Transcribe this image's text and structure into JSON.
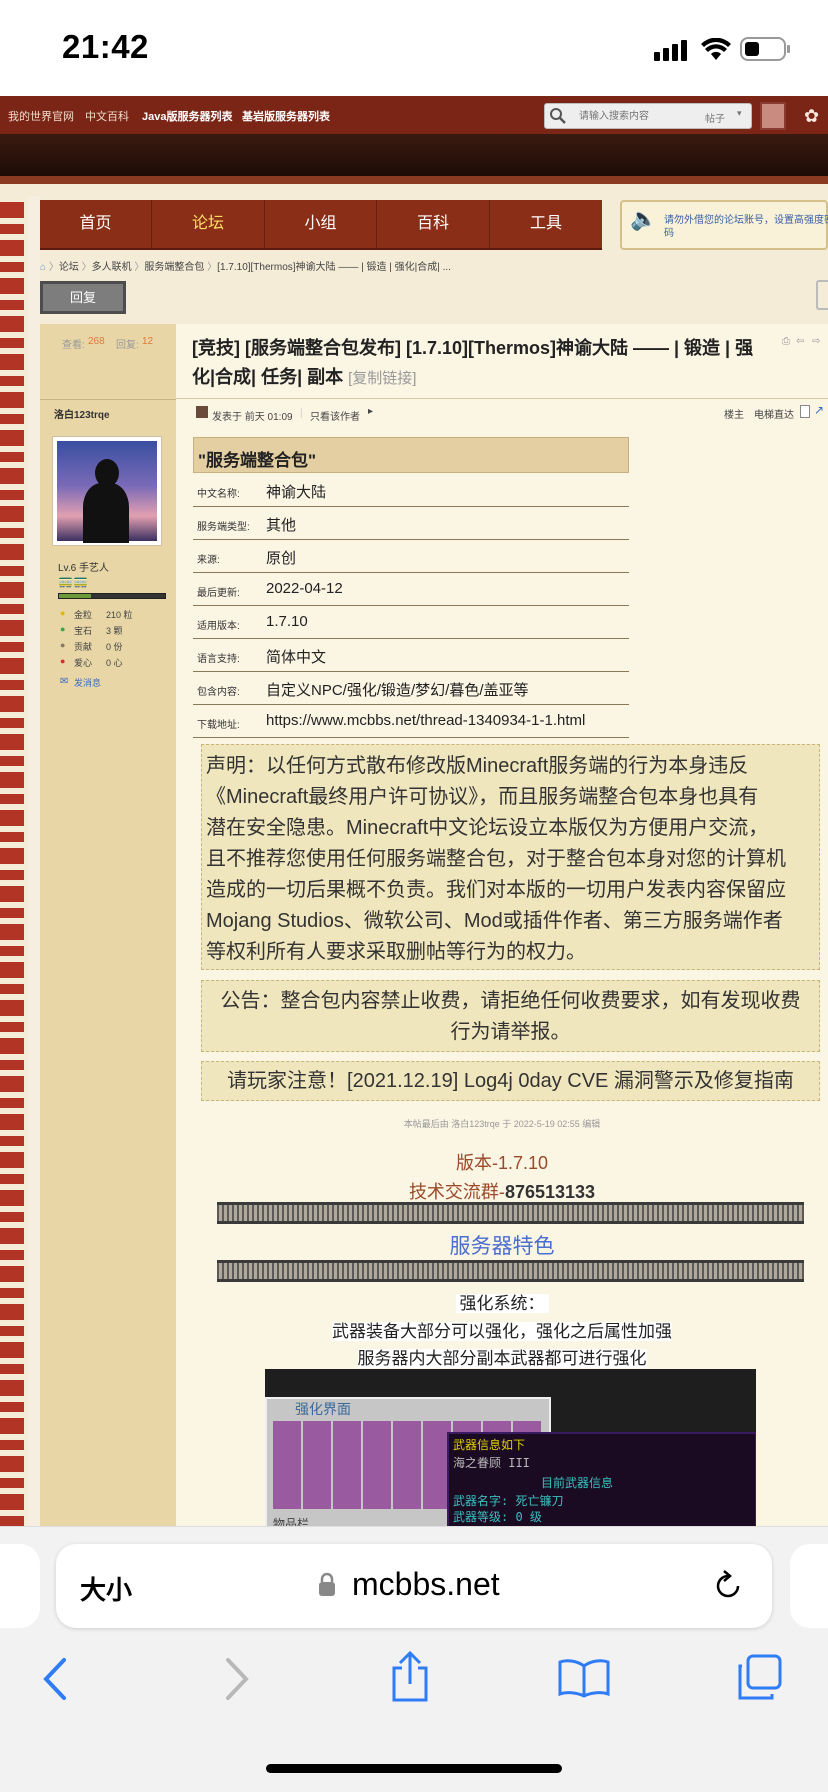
{
  "status": {
    "time": "21:42"
  },
  "topnav": {
    "links": [
      "我的世界官网",
      "中文百科",
      "Java版服务器列表",
      "基岩版服务器列表"
    ],
    "search_placeholder": "请输入搜索内容",
    "search_scope": "帖子"
  },
  "mainnav": {
    "tabs": [
      "首页",
      "论坛",
      "小组",
      "百科",
      "工具"
    ],
    "active": "论坛",
    "notice": "请勿外借您的论坛账号，设置高强度密码"
  },
  "breadcrumb": [
    "论坛",
    "多人联机",
    "服务端整合包",
    "[1.7.10][Thermos]神谕大陆 —— | 锻造 | 强化|合成| ..."
  ],
  "reply_button": "回复",
  "stats": {
    "views_label": "查看:",
    "views": "268",
    "replies_label": "回复:",
    "replies": "12"
  },
  "post": {
    "title": "[竞技] [服务端整合包发布] [1.7.10][Thermos]神谕大陆 —— | 锻造 | 强化|合成| 任务| 副本",
    "copy_link": "[复制链接]",
    "meta_posted": "发表于 前天 01:09",
    "meta_only_author": "只看该作者",
    "meta_floor": "楼主",
    "meta_jump": "电梯直达"
  },
  "author": {
    "name": "洛白123trqe",
    "level": "Lv.6 手艺人",
    "gold_label": "金粒",
    "gold": "210 粒",
    "gem_label": "宝石",
    "gem": "3 颗",
    "contrib_label": "贡献",
    "contrib": "0 份",
    "love_label": "爱心",
    "love": "0 心",
    "message": "发消息"
  },
  "info": {
    "header": "\"服务端整合包\"",
    "rows": [
      {
        "k": "中文名称:",
        "v": "神谕大陆"
      },
      {
        "k": "服务端类型:",
        "v": "其他"
      },
      {
        "k": "来源:",
        "v": "原创"
      },
      {
        "k": "最后更新:",
        "v": "2022-04-12"
      },
      {
        "k": "适用版本:",
        "v": "1.7.10"
      },
      {
        "k": "语言支持:",
        "v": "简体中文"
      },
      {
        "k": "包含内容:",
        "v": "自定义NPC/强化/锻造/梦幻/暮色/盖亚等"
      },
      {
        "k": "下载地址:",
        "v": "https://www.mcbbs.net/thread-1340934-1-1.html"
      }
    ]
  },
  "disclaimer": [
    "声明：以任何方式散布修改版Minecraft服务端的行为本身违反",
    "《Minecraft最终用户许可协议》，而且服务端整合包本身也具有",
    "潜在安全隐患。Minecraft中文论坛设立本版仅为方便用户交流，",
    "且不推荐您使用任何服务端整合包，对于整合包本身对您的计算机",
    "造成的一切后果概不负责。我们对本版的一切用户发表内容保留应",
    "Mojang Studios、微软公司、Mod或插件作者、第三方服务端作者",
    "等权利所有人要求采取删帖等行为的权力。"
  ],
  "announcement": [
    "公告：整合包内容禁止收费，请拒绝任何收费要求，如有发现收费",
    "行为请举报。"
  ],
  "warning": "请玩家注意！[2021.12.19] Log4j 0day CVE 漏洞警示及修复指南",
  "edited": "本帖最后由 洛白123trqe 于 2022-5-19 02:55 编辑",
  "body": {
    "version": "版本-1.7.10",
    "group_label": "技术交流群-",
    "group_number": "876513133",
    "features_title": "服务器特色",
    "enhance_title": "强化系统：",
    "enhance_line1": "武器装备大部分可以强化，强化之后属性加强",
    "enhance_line2": "服务器内大部分副本武器都可进行强化"
  },
  "game": {
    "panel_title": "强化界面",
    "bottom_label": "物品栏",
    "tip_title": "武器信息如下",
    "tip_item": "海之眷顾 III",
    "tip_current": "目前武器信息",
    "tip_name": "武器名字: 死亡镰刀",
    "tip_level": "武器等级: 0 级"
  },
  "browser": {
    "aa_label": "大小",
    "url": "mcbbs.net"
  },
  "colors": {
    "nav": "#8b2e18",
    "accent_blue": "#4a6fd0",
    "link_brown": "#9a4a2a"
  }
}
